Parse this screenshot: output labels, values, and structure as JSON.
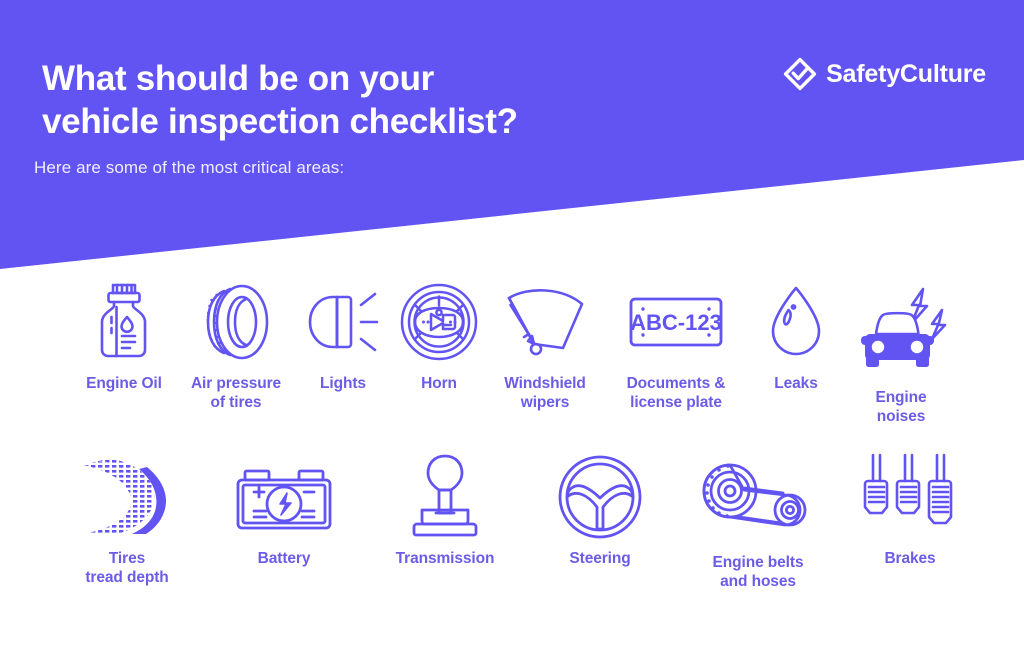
{
  "header": {
    "title": "What should be on your\nvehicle inspection checklist?",
    "subtitle": "Here are some of the most critical areas:",
    "logo_text": "SafetyCulture",
    "logo_icon": "safetyculture-diamond-check-icon",
    "background_color": "#6254F2",
    "title_color": "#FFFFFF"
  },
  "theme": {
    "accent_color": "#6254F2",
    "label_color": "#6B5CE8",
    "page_background": "#FFFFFF"
  },
  "items": {
    "row1": [
      {
        "label": "Engine Oil",
        "icon": "oil-bottle-icon"
      },
      {
        "label": "Air pressure\nof tires",
        "icon": "tire-icon"
      },
      {
        "label": "Lights",
        "icon": "headlight-icon"
      },
      {
        "label": "Horn",
        "icon": "horn-steering-wheel-icon"
      },
      {
        "label": "Windshield\nwipers",
        "icon": "windshield-wiper-icon"
      },
      {
        "label": "Documents &\nlicense plate",
        "icon": "license-plate-icon",
        "plate_text": "ABC-123"
      },
      {
        "label": "Leaks",
        "icon": "water-droplet-icon"
      },
      {
        "label": "Engine\nnoises",
        "icon": "car-noise-icon"
      }
    ],
    "row2": [
      {
        "label": "Tires\ntread depth",
        "icon": "tire-tread-marks-icon"
      },
      {
        "label": "Battery",
        "icon": "car-battery-icon"
      },
      {
        "label": "Transmission",
        "icon": "gear-shifter-icon"
      },
      {
        "label": "Steering",
        "icon": "steering-wheel-icon"
      },
      {
        "label": "Engine belts\nand hoses",
        "icon": "timing-belt-icon"
      },
      {
        "label": "Brakes",
        "icon": "brake-pedals-icon"
      }
    ]
  }
}
